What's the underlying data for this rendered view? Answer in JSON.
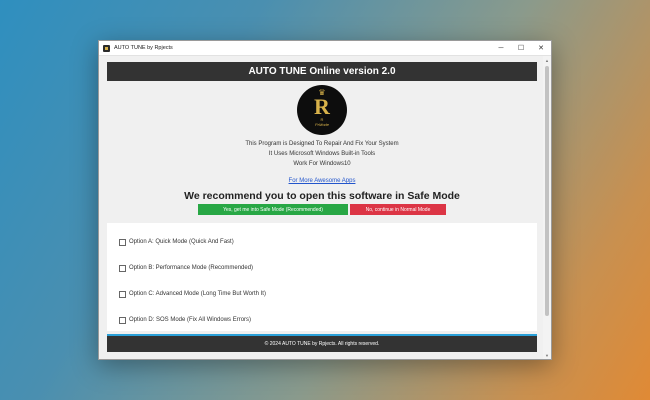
{
  "window": {
    "title": "AUTO TUNE by Rpjects",
    "minimize_glyph": "─",
    "maximize_glyph": "☐",
    "close_glyph": "✕"
  },
  "header": {
    "title": "AUTO TUNE Online version 2.0"
  },
  "logo": {
    "letter": "R",
    "crown": "♛",
    "sub1": "R",
    "sub2": "PrMode"
  },
  "info": {
    "line1": "This Program is Designed To Repair And Fix Your System",
    "line2": "It Uses Microsoft Windows Built-in Tools",
    "line3": "Work For Windows10",
    "link": "For More Awesome Apps"
  },
  "recommend": {
    "text": "We recommend you to open this software in Safe Mode",
    "safe_button": "Yes, get me into Safe Mode (Recommended)",
    "normal_button": "No, continue in Normal Mode"
  },
  "options": [
    {
      "label": "Option A: Quick Mode (Quick And Fast)"
    },
    {
      "label": "Option B: Performance Mode (Recommended)"
    },
    {
      "label": "Option C: Advanced Mode (Long Time But Worth It)"
    },
    {
      "label": "Option D: SOS Mode (Fix All Windows Errors)"
    }
  ],
  "footer": {
    "text": "© 2024 AUTO TUNE by Rpjects. All rights reserved."
  },
  "colors": {
    "header_bg": "#333333",
    "safe_green": "#28a745",
    "normal_red": "#dc3545",
    "footer_accent": "#2aa0d8",
    "link_blue": "#2255cc",
    "logo_gold": "#d8b24a"
  }
}
